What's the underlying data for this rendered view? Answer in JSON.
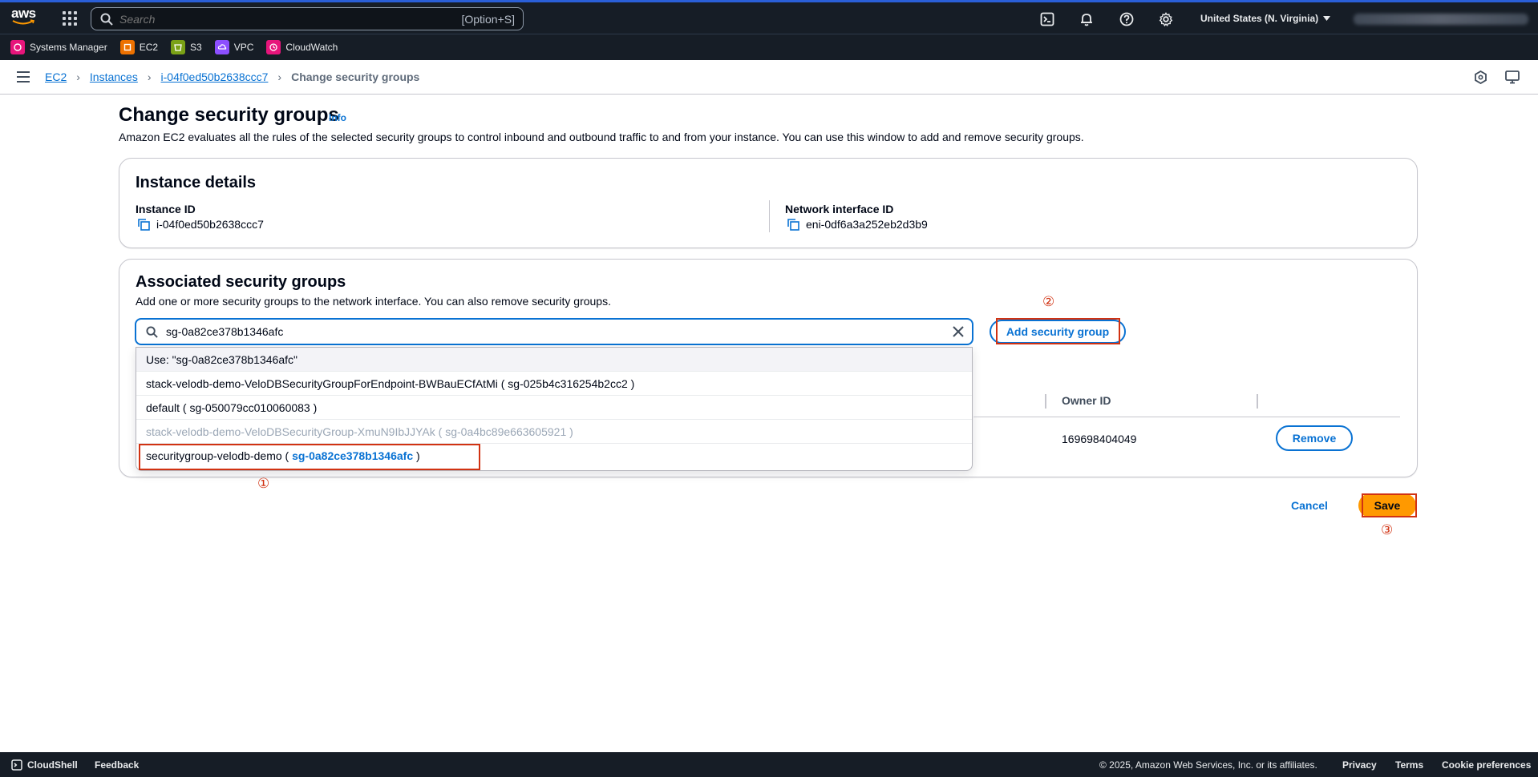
{
  "topnav": {
    "logo_text": "aws",
    "search_placeholder": "Search",
    "search_shortcut": "[Option+S]",
    "region": "United States (N. Virginia)",
    "icons": [
      "cloudshell-icon",
      "bell-icon",
      "help-icon",
      "gear-icon"
    ]
  },
  "favorites": [
    {
      "label": "Systems Manager",
      "color": "#e7157b"
    },
    {
      "label": "EC2",
      "color": "#ed7100"
    },
    {
      "label": "S3",
      "color": "#7aa116"
    },
    {
      "label": "VPC",
      "color": "#8c4fff"
    },
    {
      "label": "CloudWatch",
      "color": "#e7157b"
    }
  ],
  "breadcrumb": {
    "items": [
      "EC2",
      "Instances",
      "i-04f0ed50b2638ccc7"
    ],
    "current": "Change security groups"
  },
  "page": {
    "title": "Change security groups",
    "info": "Info",
    "description": "Amazon EC2 evaluates all the rules of the selected security groups to control inbound and outbound traffic to and from your instance. You can use this window to add and remove security groups."
  },
  "instance_details": {
    "heading": "Instance details",
    "instance_id_label": "Instance ID",
    "instance_id": "i-04f0ed50b2638ccc7",
    "eni_label": "Network interface ID",
    "eni": "eni-0df6a3a252eb2d3b9"
  },
  "associated": {
    "heading": "Associated security groups",
    "description": "Add one or more security groups to the network interface. You can also remove security groups.",
    "search_value": "sg-0a82ce378b1346afc",
    "add_button": "Add security group",
    "options": [
      {
        "text": "Use: \"sg-0a82ce378b1346afc\""
      },
      {
        "text": "stack-velodb-demo-VeloDBSecurityGroupForEndpoint-BWBauECfAtMi ( sg-025b4c316254b2cc2 )"
      },
      {
        "text": "default ( sg-050079cc010060083 )"
      },
      {
        "text": "stack-velodb-demo-VeloDBSecurityGroup-XmuN9IbJJYAk ( sg-0a4bc89e663605921 )"
      },
      {
        "name_part": "securitygroup-velodb-demo ( ",
        "id_part": "sg-0a82ce378b1346afc",
        "end_part": " )"
      }
    ],
    "owner_id_header": "Owner ID",
    "owner_id": "169698404049",
    "remove_button": "Remove"
  },
  "actions": {
    "cancel": "Cancel",
    "save": "Save"
  },
  "annotations": {
    "m1": "①",
    "m2": "②",
    "m3": "③",
    "color": "#d13212"
  },
  "footer": {
    "cloudshell": "CloudShell",
    "feedback": "Feedback",
    "copyright": "© 2025, Amazon Web Services, Inc. or its affiliates.",
    "privacy": "Privacy",
    "terms": "Terms",
    "cookies": "Cookie preferences"
  }
}
